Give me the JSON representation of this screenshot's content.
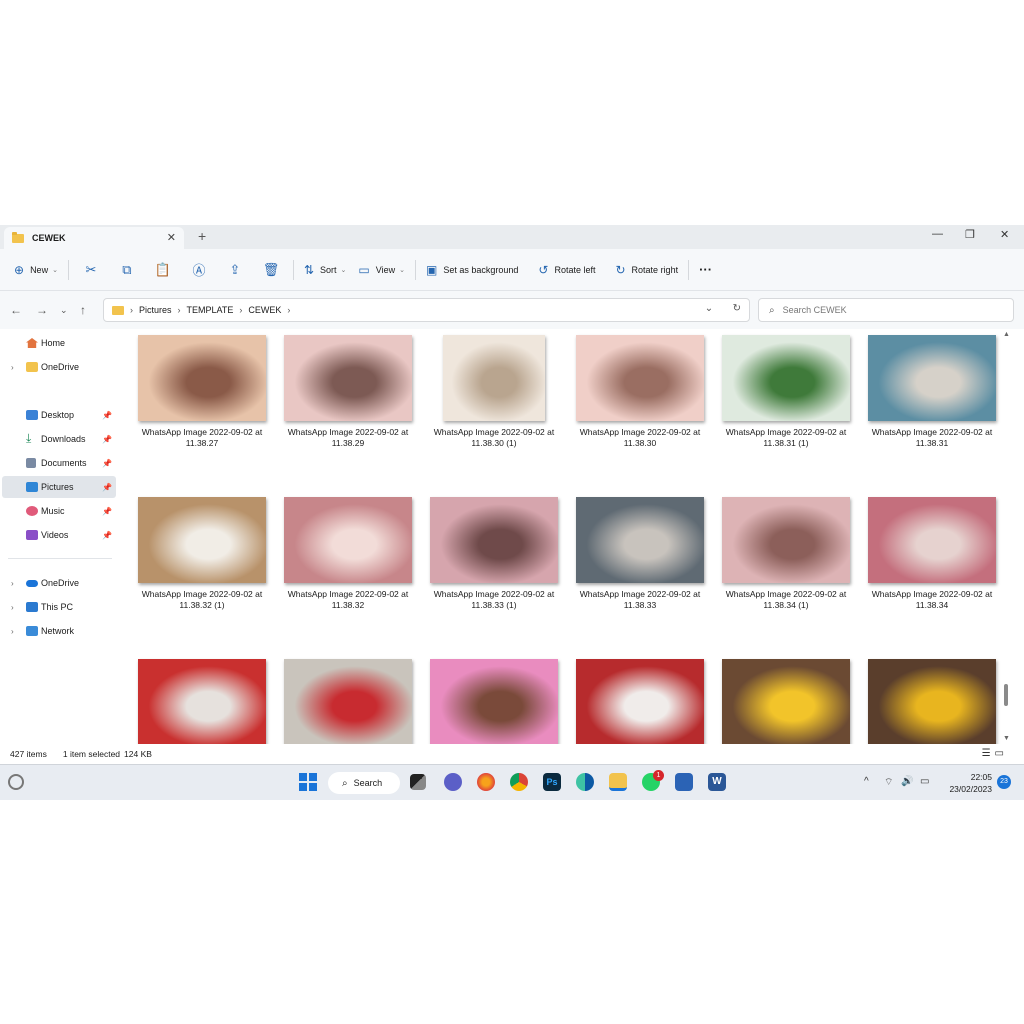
{
  "window": {
    "tab_title": "CEWEK",
    "tab_close": "✕",
    "new_tab": "+",
    "minimize": "—",
    "maximize": "❐",
    "close": "✕"
  },
  "toolbar": {
    "new_label": "New",
    "sort_label": "Sort",
    "view_label": "View",
    "set_background_label": "Set as background",
    "rotate_left_label": "Rotate left",
    "rotate_right_label": "Rotate right",
    "more": "···"
  },
  "address": {
    "crumbs": [
      "Pictures",
      "TEMPLATE",
      "CEWEK"
    ],
    "search_placeholder": "Search CEWEK"
  },
  "sidebar": {
    "items": [
      {
        "label": "Home",
        "icon": "home-icon"
      },
      {
        "label": "OneDrive",
        "icon": "cloud-icon"
      },
      {
        "label": "Desktop",
        "icon": "desktop-icon"
      },
      {
        "label": "Downloads",
        "icon": "download-icon"
      },
      {
        "label": "Documents",
        "icon": "document-icon"
      },
      {
        "label": "Pictures",
        "icon": "pictures-icon"
      },
      {
        "label": "Music",
        "icon": "music-icon"
      },
      {
        "label": "Videos",
        "icon": "video-icon"
      },
      {
        "label": "OneDrive",
        "icon": "cloud-icon"
      },
      {
        "label": "This PC",
        "icon": "computer-icon"
      },
      {
        "label": "Network",
        "icon": "network-icon"
      }
    ]
  },
  "files": [
    {
      "line1": "WhatsApp Image 2022-09-02 at",
      "line2": "11.38.27"
    },
    {
      "line1": "WhatsApp Image 2022-09-02 at",
      "line2": "11.38.29"
    },
    {
      "line1": "WhatsApp Image 2022-09-02 at",
      "line2": "11.38.30 (1)"
    },
    {
      "line1": "WhatsApp Image 2022-09-02 at",
      "line2": "11.38.30"
    },
    {
      "line1": "WhatsApp Image 2022-09-02 at",
      "line2": "11.38.31 (1)"
    },
    {
      "line1": "WhatsApp Image 2022-09-02 at",
      "line2": "11.38.31"
    },
    {
      "line1": "WhatsApp Image 2022-09-02 at",
      "line2": "11.38.32 (1)"
    },
    {
      "line1": "WhatsApp Image 2022-09-02 at",
      "line2": "11.38.32"
    },
    {
      "line1": "WhatsApp Image 2022-09-02 at",
      "line2": "11.38.33 (1)"
    },
    {
      "line1": "WhatsApp Image 2022-09-02 at",
      "line2": "11.38.33"
    },
    {
      "line1": "WhatsApp Image 2022-09-02 at",
      "line2": "11.38.34 (1)"
    },
    {
      "line1": "WhatsApp Image 2022-09-02 at",
      "line2": "11.38.34"
    }
  ],
  "thumb_colors": [
    [
      "#e7c3a9",
      "#8a5a48"
    ],
    [
      "#e9c7c4",
      "#7d5a54"
    ],
    [
      "#efe6dc",
      "#b9a58f"
    ],
    [
      "#f0cfc8",
      "#9a6e62"
    ],
    [
      "#dfeadf",
      "#3f7a3a"
    ],
    [
      "#5c8ea3",
      "#d6d1c9"
    ],
    [
      "#b8926a",
      "#f1ede6"
    ],
    [
      "#c7868a",
      "#f2dcd8"
    ],
    [
      "#d6a5ad",
      "#6f4a4a"
    ],
    [
      "#5f6a73",
      "#c8c3bd"
    ],
    [
      "#ddb3b5",
      "#8c5f5a"
    ],
    [
      "#c46f7d",
      "#e6d2cf"
    ],
    [
      "#c9302f",
      "#e6e1dd"
    ],
    [
      "#c9c4bc",
      "#c82b30"
    ],
    [
      "#e98cbf",
      "#7a4a3a"
    ],
    [
      "#b72b2d",
      "#f0ecea"
    ],
    [
      "#6b4a33",
      "#f2c42a"
    ],
    [
      "#5a3e2c",
      "#e8b51f"
    ]
  ],
  "status": {
    "items_count": "427 items",
    "selected": "1 item selected",
    "size": "124 KB"
  },
  "taskbar": {
    "search_label": "Search",
    "whatsapp_badge": "1",
    "time": "22:05",
    "date": "23/02/2023",
    "notifications": "23"
  }
}
